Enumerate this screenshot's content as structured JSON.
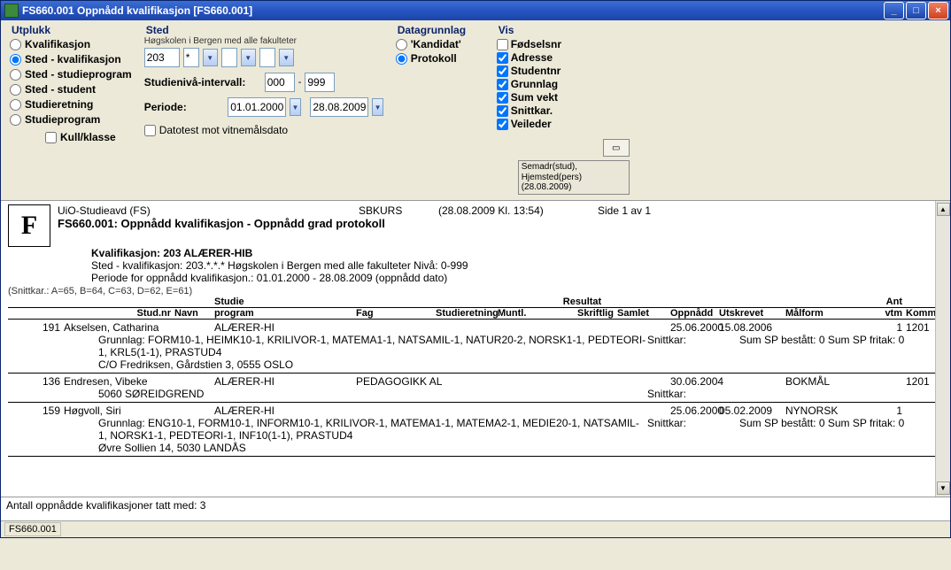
{
  "window": {
    "title": "FS660.001 Oppnådd kvalifikasjon [FS660.001]"
  },
  "utplukk": {
    "legend": "Utplukk",
    "options": [
      {
        "label": "Kvalifikasjon",
        "value": "kvalifikasjon",
        "checked": false
      },
      {
        "label": "Sted - kvalifikasjon",
        "value": "sted-kvalifikasjon",
        "checked": true
      },
      {
        "label": "Sted - studieprogram",
        "value": "sted-studieprogram",
        "checked": false
      },
      {
        "label": "Sted - student",
        "value": "sted-student",
        "checked": false
      },
      {
        "label": "Studieretning",
        "value": "studieretning",
        "checked": false
      },
      {
        "label": "Studieprogram",
        "value": "studieprogram",
        "checked": false
      }
    ],
    "kull_klasse_label": "Kull/klasse",
    "kull_klasse_checked": false
  },
  "sted": {
    "legend": "Sted",
    "note": "Høgskolen i Bergen med alle fakulteter",
    "code": "203",
    "a": "*",
    "niv_label": "Studienivå-intervall:",
    "niv_from": "000",
    "niv_to": "999",
    "periode_label": "Periode:",
    "periode_from": "01.01.2000",
    "periode_to": "28.08.2009",
    "datotest_label": "Datotest mot vitnemålsdato",
    "datotest_checked": false
  },
  "datagrunnlag": {
    "legend": "Datagrunnlag",
    "options": [
      {
        "label": "'Kandidat'",
        "checked": false
      },
      {
        "label": "Protokoll",
        "checked": true
      }
    ]
  },
  "vis": {
    "legend": "Vis",
    "items": [
      {
        "label": "Fødselsnr",
        "checked": false
      },
      {
        "label": "Adresse",
        "checked": true
      },
      {
        "label": "Studentnr",
        "checked": true
      },
      {
        "label": "Grunnlag",
        "checked": true
      },
      {
        "label": "Sum vekt",
        "checked": true
      },
      {
        "label": "Snittkar.",
        "checked": true
      },
      {
        "label": "Veileder",
        "checked": true
      }
    ]
  },
  "mini_status": "Semadr(stud), Hjemsted(pers) (28.08.2009)",
  "report": {
    "header_left": "UiO-Studieavd (FS)",
    "header_center": "SBKURS",
    "header_time": "(28.08.2009 Kl. 13:54)",
    "header_page": "Side 1 av 1",
    "code_title": "FS660.001: Oppnådd kvalifikasjon  - Oppnådd grad protokoll",
    "kvalifikasjon": "Kvalifikasjon: 203 ALÆRER-HIB",
    "sted_line": "Sted - kvalifikasjon: 203.*.*.* Høgskolen i Bergen med alle fakulteter Nivå: 0-999",
    "periode_line": "Periode for oppnådd kvalifikasjon.: 01.01.2000 - 28.08.2009 (oppnådd dato)",
    "snitt_note": "(Snittkar.: A=65, B=64, C=63, D=62, E=61)",
    "col_heads": {
      "stud": "Stud.nr",
      "navn": "Navn",
      "studieprogram_top": "Studie",
      "studieprogram_bot": "program",
      "fag": "Fag",
      "studieretning": "Studieretning",
      "muntl": "Muntl.",
      "resultat_top": "Resultat",
      "skriftlig": "Skriftlig",
      "samlet": "Samlet",
      "oppnadd": "Oppnådd",
      "utskrevet": "Utskrevet",
      "malform": "Målform",
      "ant_top": "Ant",
      "vtm": "vtm",
      "komm": "Komm."
    },
    "rows": [
      {
        "stud": "191",
        "navn": "Akselsen, Catharina",
        "program": "ALÆRER-HI",
        "fag": "",
        "studieretning": "",
        "oppnadd": "25.06.2000",
        "utskrevet": "15.08.2006",
        "malform": "",
        "vtm": "1",
        "komm": "1201",
        "grunnlag": "Grunnlag: FORM10-1, HEIMK10-1, KRILIVOR-1, MATEMA1-1, NATSAMIL-1, NATUR20-2, NORSK1-1, PEDTEORI-1, KRL5(1-1), PRASTUD4",
        "snitt": "Snittkar:",
        "sum": "Sum SP bestått: 0 Sum SP fritak: 0",
        "addr": "C/O Fredriksen, Gårdstien 3, 0555 OSLO"
      },
      {
        "stud": "136",
        "navn": "Endresen, Vibeke",
        "program": "ALÆRER-HI",
        "fag": "PEDAGOGIKK AL",
        "studieretning": "",
        "oppnadd": "30.06.2004",
        "utskrevet": "",
        "malform": "BOKMÅL",
        "vtm": "",
        "komm": "1201",
        "grunnlag": "",
        "snitt": "Snittkar:",
        "sum": "",
        "addr": "5060 SØREIDGREND"
      },
      {
        "stud": "159",
        "navn": "Høgvoll, Siri",
        "program": "ALÆRER-HI",
        "fag": "",
        "studieretning": "",
        "oppnadd": "25.06.2000",
        "utskrevet": "05.02.2009",
        "malform": "NYNORSK",
        "vtm": "1",
        "komm": "",
        "grunnlag": "Grunnlag: ENG10-1, FORM10-1, INFORM10-1, KRILIVOR-1, MATEMA1-1, MATEMA2-1, MEDIE20-1, NATSAMIL-1, NORSK1-1, PEDTEORI-1, INF10(1-1), PRASTUD4",
        "snitt": "Snittkar:",
        "sum": "Sum SP bestått: 0 Sum SP fritak: 0",
        "addr": "Øvre Sollien 14, 5030 LANDÅS"
      }
    ],
    "footer": "Antall oppnådde kvalifikasjoner tatt med: 3"
  },
  "statusbar": "FS660.001"
}
